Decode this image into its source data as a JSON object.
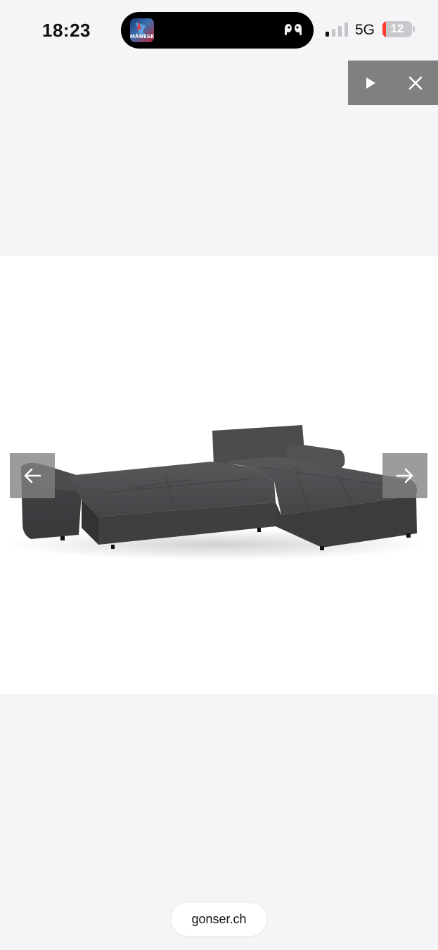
{
  "status_bar": {
    "time": "18:23",
    "network": "5G",
    "battery_level": "12",
    "battery_fraction": 0.12,
    "signal_bars_active": 1,
    "signal_bars_total": 4,
    "now_playing_art_text": "MÅNESKIN",
    "icons": {
      "album_art": "album-art-icon",
      "airpods": "airpods-icon",
      "signal": "cellular-signal-icon",
      "battery": "battery-icon"
    }
  },
  "ad_controls": {
    "icons": {
      "play": "play-icon",
      "close": "close-icon"
    }
  },
  "gallery": {
    "image_subject": "sofa-product-image",
    "icons": {
      "prev": "arrow-left-icon",
      "next": "arrow-right-icon"
    }
  },
  "browser": {
    "url": "gonser.ch"
  },
  "colors": {
    "background": "#f5f5f7",
    "image_background": "#ffffff",
    "overlay_button": "#808080",
    "battery_low": "#ff3b30",
    "sofa_fabric": "#4a4a4d"
  }
}
